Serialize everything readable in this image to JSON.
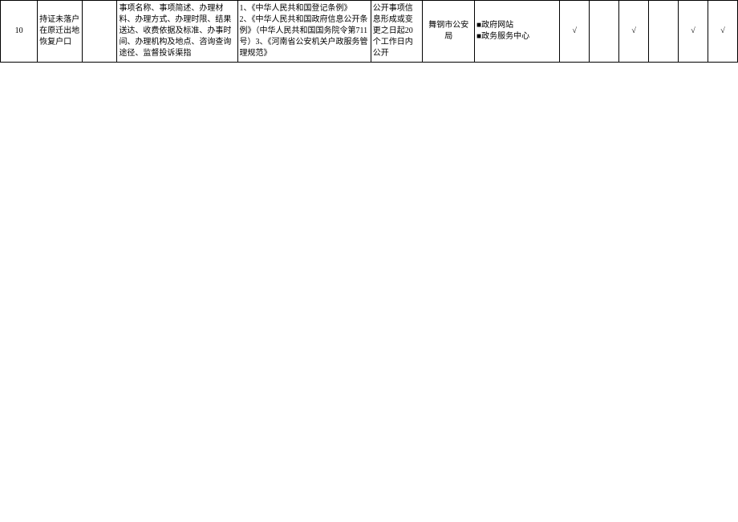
{
  "row": {
    "num": "10",
    "name": "持证未落户在原迁出地恢复户口",
    "blank": "",
    "content": "事项名称、事项简述、办理材料、办理方式、办理时限、结果送达、收费依据及标准、办事时间、办理机构及地点、咨询查询途径、监督投诉渠指",
    "basis": "1、《中华人民共和国登记条例》\n2、《中华人民共和国政府信息公开条例》（中华人民共和国国务院令第711号）3、《河南省公安机关户政服务管理规范》",
    "time": "公开事项信息形成或变更之日起20个工作日内公开",
    "subject": "舞钢市公安局",
    "channel": "■政府网站\n■政务服务中心",
    "checks": [
      "√",
      "",
      "√",
      "",
      "√",
      "√"
    ]
  }
}
